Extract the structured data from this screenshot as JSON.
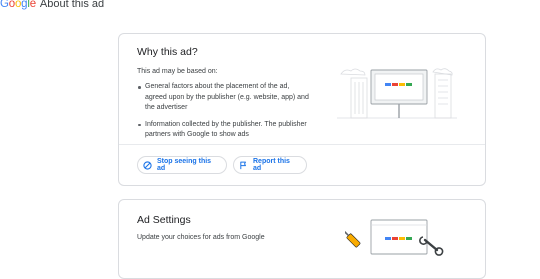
{
  "header": {
    "logo_letters": [
      {
        "ch": "G",
        "color": "#4285F4"
      },
      {
        "ch": "o",
        "color": "#EA4335"
      },
      {
        "ch": "o",
        "color": "#FBBC05"
      },
      {
        "ch": "g",
        "color": "#4285F4"
      },
      {
        "ch": "l",
        "color": "#34A853"
      },
      {
        "ch": "e",
        "color": "#EA4335"
      }
    ],
    "title": "About this ad"
  },
  "why_card": {
    "title": "Why this ad?",
    "intro": "This ad may be based on:",
    "reasons": [
      "General factors about the placement of the ad, agreed upon by the publisher (e.g. website, app) and the advertiser",
      "Information collected by the publisher. The publisher partners with Google to show ads"
    ],
    "stop_label": "Stop seeing this ad",
    "report_label": "Report this ad",
    "illustration": "billboard-illustration"
  },
  "settings_card": {
    "title": "Ad Settings",
    "subtitle": "Update your choices for ads from Google",
    "illustration": "tools-illustration"
  },
  "colors": {
    "blue": "#4285F4",
    "red": "#EA4335",
    "yellow": "#FBBC05",
    "green": "#34A853",
    "link": "#1a73e8",
    "border": "#dadce0"
  }
}
